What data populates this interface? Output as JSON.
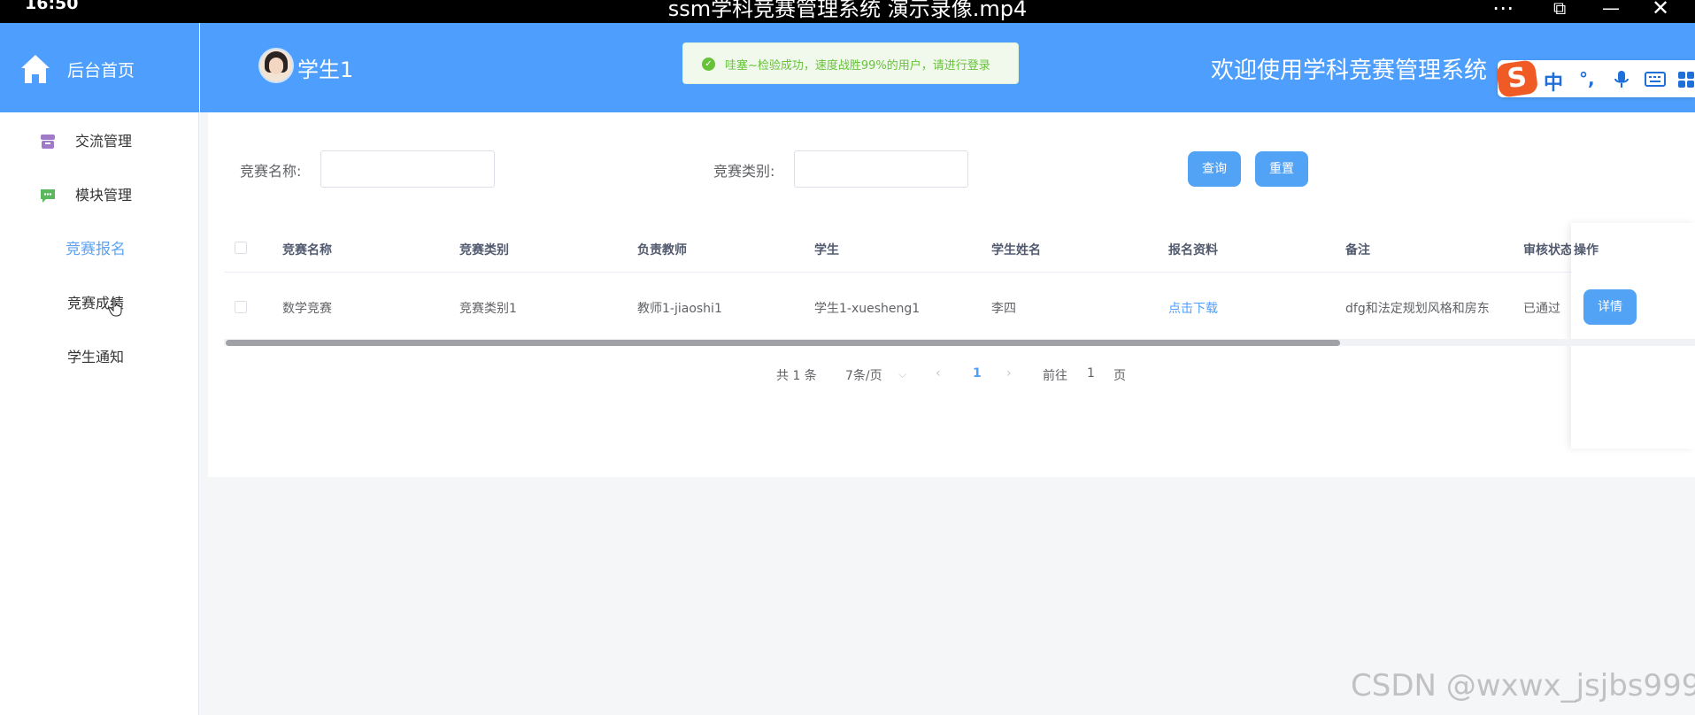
{
  "player": {
    "time": "16:50",
    "title": "ssm学科竞赛管理系统 演示录像.mp4",
    "more_icon": "⋯",
    "pip_icon": "⧉",
    "minimize_icon": "—",
    "close_icon": "✕"
  },
  "sidebar": {
    "home_label": "后台首页",
    "items": [
      {
        "label": "交流管理",
        "icon": "archive-icon",
        "color": "#a07ac9"
      },
      {
        "label": "模块管理",
        "icon": "chat-icon",
        "color": "#5cb85c"
      },
      {
        "label": "竞赛报名",
        "active": true
      },
      {
        "label": "竞赛成绩"
      },
      {
        "label": "学生通知"
      }
    ]
  },
  "header": {
    "user_name": "学生1",
    "welcome": "欢迎使用学科竞赛管理系统"
  },
  "toast": {
    "text": "哇塞~检验成功，速度战胜99%的用户，请进行登录"
  },
  "ime": {
    "logo": "S",
    "lang": "中",
    "punct": "°,",
    "mic": "🎤",
    "keyboard": "⌨",
    "grid": "▦"
  },
  "search": {
    "name_label": "竞赛名称:",
    "name_value": "",
    "type_label": "竞赛类别:",
    "type_value": "",
    "query_button": "查询",
    "reset_button": "重置"
  },
  "table": {
    "headers": [
      "竞赛名称",
      "竞赛类别",
      "负责教师",
      "学生",
      "学生姓名",
      "报名资料",
      "备注",
      "审核状态",
      "操作"
    ],
    "rows": [
      {
        "name": "数学竞赛",
        "type": "竞赛类别1",
        "teacher": "教师1-jiaoshi1",
        "student": "学生1-xuesheng1",
        "student_name": "李四",
        "material": "点击下载",
        "remark": "dfg和法定规划风格和房东",
        "status": "已通过",
        "action": "详情"
      }
    ]
  },
  "pagination": {
    "total": "共 1 条",
    "page_size": "7条/页",
    "current_page": "1",
    "goto_label": "前往",
    "goto_value": "1",
    "page_suffix": "页"
  },
  "watermark": "CSDN @wxwx_jsjbs999",
  "colors": {
    "primary": "#4e9ffd",
    "success": "#67c23a",
    "button": "#52a2f5"
  }
}
